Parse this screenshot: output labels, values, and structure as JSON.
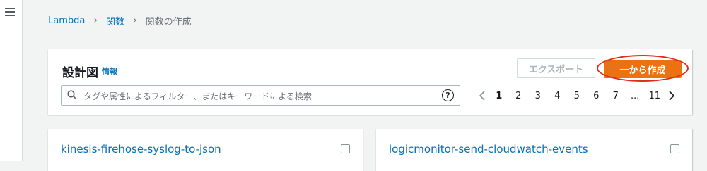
{
  "breadcrumb": {
    "root": "Lambda",
    "functions": "関数",
    "current": "関数の作成"
  },
  "blueprints": {
    "title": "設計図",
    "info": "情報",
    "export_label": "エクスポート",
    "create_label": "一から作成",
    "search_placeholder": "タグや属性によるフィルター、またはキーワードによる検索",
    "help": "?",
    "pages": [
      "1",
      "2",
      "3",
      "4",
      "5",
      "6",
      "7",
      "...",
      "11"
    ],
    "current_page": "1"
  },
  "cards": [
    {
      "title": "kinesis-firehose-syslog-to-json"
    },
    {
      "title": "logicmonitor-send-cloudwatch-events"
    }
  ],
  "colors": {
    "accent": "#ec7211",
    "link": "#0073bb",
    "annotation": "#e02c1b"
  }
}
